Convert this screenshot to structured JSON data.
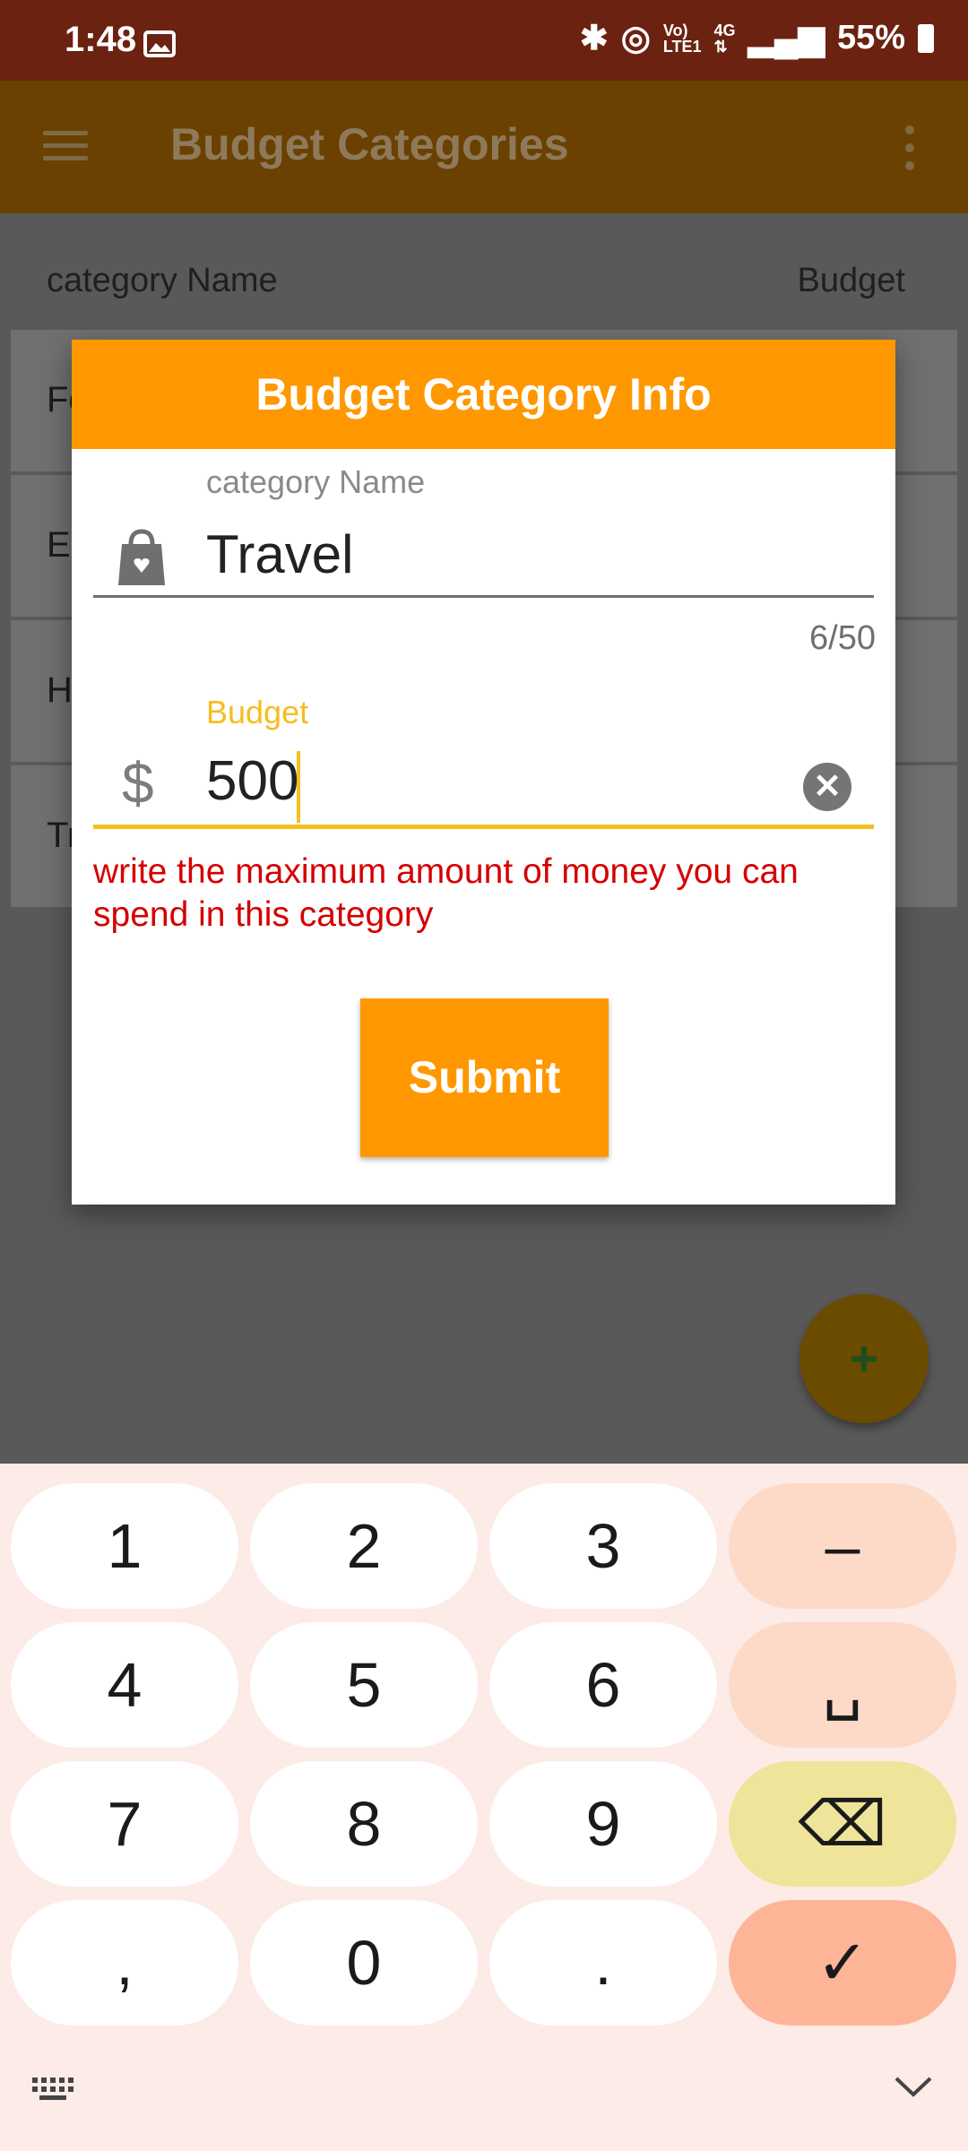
{
  "status_bar": {
    "time": "1:48",
    "battery": "55%"
  },
  "app_bar": {
    "title": "Budget Categories"
  },
  "list": {
    "headers": {
      "name": "category Name",
      "budget": "Budget"
    },
    "rows": [
      "Fo",
      "En",
      "H",
      "Tr"
    ]
  },
  "fab": {
    "label": "+"
  },
  "dialog": {
    "title": "Budget Category Info",
    "name_field": {
      "label": "category Name",
      "value": "Travel",
      "counter": "6/50"
    },
    "budget_field": {
      "label": "Budget",
      "value": "500",
      "hint": "write the maximum amount of money you can spend in this category"
    },
    "submit_label": "Submit"
  },
  "keyboard": {
    "keys": [
      [
        "1",
        "2",
        "3",
        "–"
      ],
      [
        "4",
        "5",
        "6",
        "␣"
      ],
      [
        "7",
        "8",
        "9",
        "⌫"
      ],
      [
        ",",
        "0",
        ".",
        "✓"
      ]
    ]
  },
  "colors": {
    "accent": "#FF9800",
    "focus": "#F5BE1E",
    "error": "#D50000",
    "status_bar": "#6B2210"
  }
}
